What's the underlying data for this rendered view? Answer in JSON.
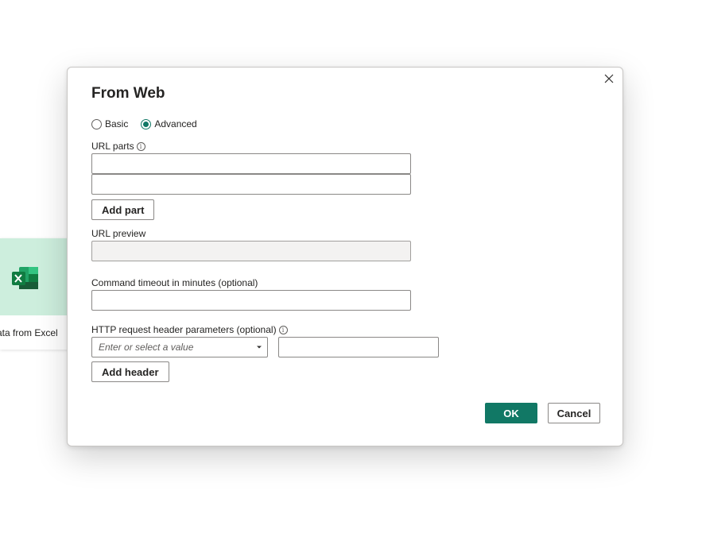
{
  "background": {
    "card_label": "ata from Excel",
    "card_icon": "excel-icon"
  },
  "dialog": {
    "title": "From Web",
    "close_icon": "close-icon",
    "mode": {
      "basic_label": "Basic",
      "advanced_label": "Advanced",
      "selected": "Advanced"
    },
    "url_parts": {
      "label": "URL parts",
      "info_icon": "info-icon",
      "part1_value": "",
      "part2_value": "",
      "add_part_label": "Add part"
    },
    "url_preview": {
      "label": "URL preview",
      "value": ""
    },
    "command_timeout": {
      "label": "Command timeout in minutes (optional)",
      "value": ""
    },
    "http_headers": {
      "label": "HTTP request header parameters (optional)",
      "info_icon": "info-icon",
      "name_placeholder": "Enter or select a value",
      "value": "",
      "add_header_label": "Add header"
    },
    "ok_label": "OK",
    "cancel_label": "Cancel"
  },
  "colors": {
    "accent": "#117865",
    "card_bg": "#cdeedd"
  }
}
